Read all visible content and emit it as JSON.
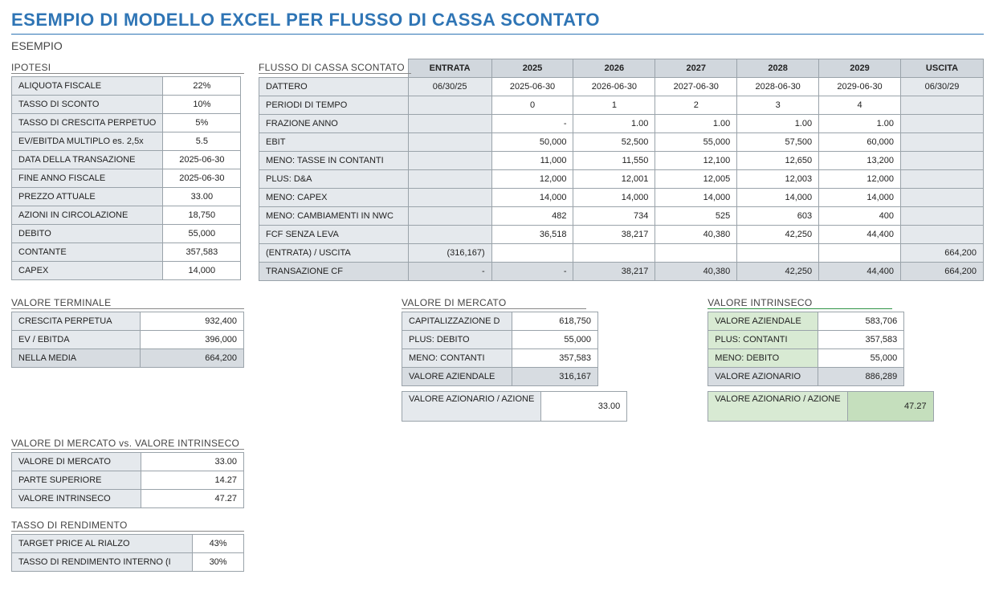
{
  "title": "ESEMPIO DI MODELLO EXCEL PER FLUSSO DI CASSA SCONTATO",
  "subtitle": "ESEMPIO",
  "ipotesi": {
    "heading": "IPOTESI",
    "rows": [
      {
        "label": "ALIQUOTA FISCALE",
        "value": "22%"
      },
      {
        "label": "TASSO DI SCONTO",
        "value": "10%"
      },
      {
        "label": "TASSO DI CRESCITA PERPETUO",
        "value": "5%"
      },
      {
        "label": "EV/EBITDA MULTIPLO   es. 2,5x",
        "value": "5.5"
      },
      {
        "label": "DATA DELLA TRANSAZIONE",
        "value": "2025-06-30"
      },
      {
        "label": "FINE ANNO FISCALE",
        "value": "2025-06-30"
      },
      {
        "label": "PREZZO ATTUALE",
        "value": "33.00"
      },
      {
        "label": "AZIONI IN CIRCOLAZIONE",
        "value": "18,750"
      },
      {
        "label": "DEBITO",
        "value": "55,000"
      },
      {
        "label": "CONTANTE",
        "value": "357,583"
      },
      {
        "label": "CAPEX",
        "value": "14,000"
      }
    ]
  },
  "dcf": {
    "heading": "FLUSSO DI CASSA SCONTATO",
    "headers": [
      "ENTRATA",
      "2025",
      "2026",
      "2027",
      "2028",
      "2029",
      "USCITA"
    ],
    "rows": [
      {
        "label": "DATTERO",
        "cells": [
          "06/30/25",
          "2025-06-30",
          "2026-06-30",
          "2027-06-30",
          "2028-06-30",
          "2029-06-30",
          "06/30/29"
        ],
        "center": true
      },
      {
        "label": "PERIODI DI TEMPO",
        "cells": [
          "",
          "0",
          "1",
          "2",
          "3",
          "4",
          ""
        ],
        "center": true
      },
      {
        "label": "FRAZIONE ANNO",
        "cells": [
          "",
          "-",
          "1.00",
          "1.00",
          "1.00",
          "1.00",
          ""
        ]
      },
      {
        "label": "EBIT",
        "cells": [
          "",
          "50,000",
          "52,500",
          "55,000",
          "57,500",
          "60,000",
          ""
        ]
      },
      {
        "label": "MENO: TASSE IN CONTANTI",
        "cells": [
          "",
          "11,000",
          "11,550",
          "12,100",
          "12,650",
          "13,200",
          ""
        ]
      },
      {
        "label": "PLUS: D&A",
        "cells": [
          "",
          "12,000",
          "12,001",
          "12,005",
          "12,003",
          "12,000",
          ""
        ]
      },
      {
        "label": "MENO: CAPEX",
        "cells": [
          "",
          "14,000",
          "14,000",
          "14,000",
          "14,000",
          "14,000",
          ""
        ]
      },
      {
        "label": "MENO: CAMBIAMENTI IN NWC",
        "cells": [
          "",
          "482",
          "734",
          "525",
          "603",
          "400",
          ""
        ]
      },
      {
        "label": "FCF SENZA LEVA",
        "cells": [
          "",
          "36,518",
          "38,217",
          "40,380",
          "42,250",
          "44,400",
          ""
        ]
      },
      {
        "label": "(ENTRATA) / USCITA",
        "cells": [
          "(316,167)",
          "",
          "",
          "",
          "",
          "",
          "664,200"
        ]
      },
      {
        "label": "TRANSAZIONE CF",
        "cells": [
          "-",
          "-",
          "38,217",
          "40,380",
          "42,250",
          "44,400",
          "664,200"
        ],
        "sum": true
      }
    ]
  },
  "valore_terminale": {
    "heading": "VALORE TERMINALE",
    "rows": [
      {
        "label": "CRESCITA PERPETUA",
        "value": "932,400"
      },
      {
        "label": "EV / EBITDA",
        "value": "396,000"
      },
      {
        "label": "NELLA MEDIA",
        "value": "664,200",
        "shade": true
      }
    ]
  },
  "valore_mercato": {
    "heading": "VALORE DI MERCATO",
    "rows": [
      {
        "label": "CAPITALIZZAZIONE D",
        "value": "618,750"
      },
      {
        "label": "PLUS: DEBITO",
        "value": "55,000"
      },
      {
        "label": "MENO: CONTANTI",
        "value": "357,583"
      },
      {
        "label": "VALORE AZIENDALE",
        "value": "316,167",
        "shade": true
      }
    ],
    "footer": {
      "label": "VALORE AZIONARIO / AZIONE",
      "value": "33.00"
    }
  },
  "valore_intrinseco": {
    "heading": "VALORE INTRINSECO",
    "rows": [
      {
        "label": "VALORE AZIENDALE",
        "value": "583,706",
        "g": true
      },
      {
        "label": "PLUS: CONTANTI",
        "value": "357,583",
        "g": true
      },
      {
        "label": "MENO: DEBITO",
        "value": "55,000",
        "g": true
      },
      {
        "label": "VALORE AZIONARIO",
        "value": "886,289",
        "shade": true
      }
    ],
    "footer": {
      "label": "VALORE AZIONARIO / AZIONE",
      "value": "47.27"
    }
  },
  "mercato_vs_intrinseco": {
    "heading": "VALORE DI MERCATO vs. VALORE INTRINSECO",
    "rows": [
      {
        "label": "VALORE DI MERCATO",
        "value": "33.00"
      },
      {
        "label": "PARTE SUPERIORE",
        "value": "14.27"
      },
      {
        "label": "VALORE INTRINSECO",
        "value": "47.27"
      }
    ]
  },
  "tasso_rendimento": {
    "heading": "TASSO DI RENDIMENTO",
    "rows": [
      {
        "label": "TARGET PRICE AL RIALZO",
        "value": "43%"
      },
      {
        "label": "TASSO DI RENDIMENTO INTERNO (I",
        "value": "30%"
      }
    ]
  }
}
